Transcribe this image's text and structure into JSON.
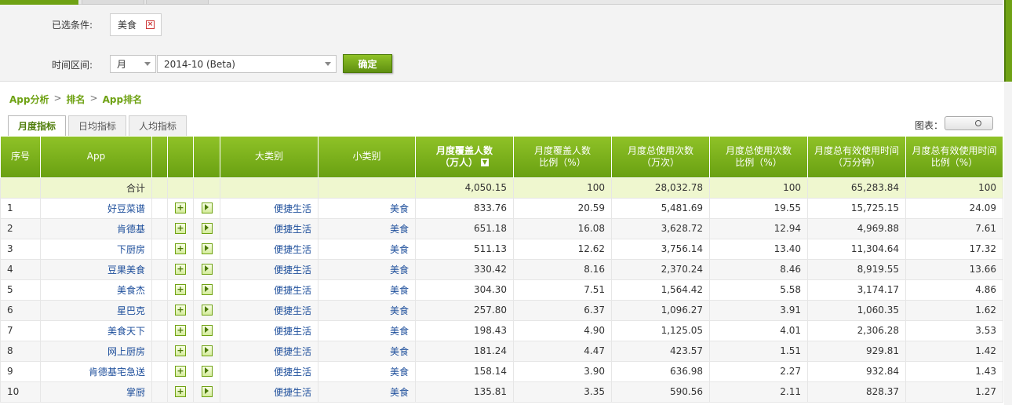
{
  "filters": {
    "selected_label": "已选条件:",
    "selected_chip": "美食",
    "time_label": "时间区间:",
    "period_value": "月",
    "month_value": "2014-10 (Beta)",
    "confirm_label": "确定"
  },
  "breadcrumb": [
    "App分析",
    "排名",
    "App排名"
  ],
  "sub_tabs": [
    "月度指标",
    "日均指标",
    "人均指标"
  ],
  "chart_label": "图表：",
  "table": {
    "headers": {
      "rank": "序号",
      "app": "App",
      "category": "大类别",
      "subcategory": "小类别",
      "cover_1": "月度覆盖人数",
      "cover_2": "（万人）",
      "cover_ratio_1": "月度覆盖人数",
      "cover_ratio_2": "比例（%）",
      "uses_1": "月度总使用次数",
      "uses_2": "（万次）",
      "uses_ratio_1": "月度总使用次数",
      "uses_ratio_2": "比例（%）",
      "time_1": "月度总有效使用时间",
      "time_2": "（万分钟）",
      "time_ratio_1": "月度总有效使用时间",
      "time_ratio_2": "比例（%）"
    },
    "total": {
      "label": "合计",
      "cover": "4,050.15",
      "cover_ratio": "100",
      "uses": "28,032.78",
      "uses_ratio": "100",
      "time": "65,283.84",
      "time_ratio": "100"
    },
    "rows": [
      {
        "rank": "1",
        "app": "好豆菜谱",
        "cat": "便捷生活",
        "sub": "美食",
        "cover": "833.76",
        "cover_ratio": "20.59",
        "uses": "5,481.69",
        "uses_ratio": "19.55",
        "time": "15,725.15",
        "time_ratio": "24.09"
      },
      {
        "rank": "2",
        "app": "肯德基",
        "cat": "便捷生活",
        "sub": "美食",
        "cover": "651.18",
        "cover_ratio": "16.08",
        "uses": "3,628.72",
        "uses_ratio": "12.94",
        "time": "4,969.88",
        "time_ratio": "7.61"
      },
      {
        "rank": "3",
        "app": "下厨房",
        "cat": "便捷生活",
        "sub": "美食",
        "cover": "511.13",
        "cover_ratio": "12.62",
        "uses": "3,756.14",
        "uses_ratio": "13.40",
        "time": "11,304.64",
        "time_ratio": "17.32"
      },
      {
        "rank": "4",
        "app": "豆果美食",
        "cat": "便捷生活",
        "sub": "美食",
        "cover": "330.42",
        "cover_ratio": "8.16",
        "uses": "2,370.24",
        "uses_ratio": "8.46",
        "time": "8,919.55",
        "time_ratio": "13.66"
      },
      {
        "rank": "5",
        "app": "美食杰",
        "cat": "便捷生活",
        "sub": "美食",
        "cover": "304.30",
        "cover_ratio": "7.51",
        "uses": "1,564.42",
        "uses_ratio": "5.58",
        "time": "3,174.17",
        "time_ratio": "4.86"
      },
      {
        "rank": "6",
        "app": "星巴克",
        "cat": "便捷生活",
        "sub": "美食",
        "cover": "257.80",
        "cover_ratio": "6.37",
        "uses": "1,096.27",
        "uses_ratio": "3.91",
        "time": "1,060.35",
        "time_ratio": "1.62"
      },
      {
        "rank": "7",
        "app": "美食天下",
        "cat": "便捷生活",
        "sub": "美食",
        "cover": "198.43",
        "cover_ratio": "4.90",
        "uses": "1,125.05",
        "uses_ratio": "4.01",
        "time": "2,306.28",
        "time_ratio": "3.53"
      },
      {
        "rank": "8",
        "app": "网上厨房",
        "cat": "便捷生活",
        "sub": "美食",
        "cover": "181.24",
        "cover_ratio": "4.47",
        "uses": "423.57",
        "uses_ratio": "1.51",
        "time": "929.81",
        "time_ratio": "1.42"
      },
      {
        "rank": "9",
        "app": "肯德基宅急送",
        "cat": "便捷生活",
        "sub": "美食",
        "cover": "158.14",
        "cover_ratio": "3.90",
        "uses": "636.98",
        "uses_ratio": "2.27",
        "time": "932.84",
        "time_ratio": "1.43"
      },
      {
        "rank": "10",
        "app": "掌厨",
        "cat": "便捷生活",
        "sub": "美食",
        "cover": "135.81",
        "cover_ratio": "3.35",
        "uses": "590.56",
        "uses_ratio": "2.11",
        "time": "828.37",
        "time_ratio": "1.27"
      }
    ]
  },
  "colors": {
    "accent": "#6fa214",
    "link": "#1d4e9b",
    "total_row": "#eff7cf"
  }
}
